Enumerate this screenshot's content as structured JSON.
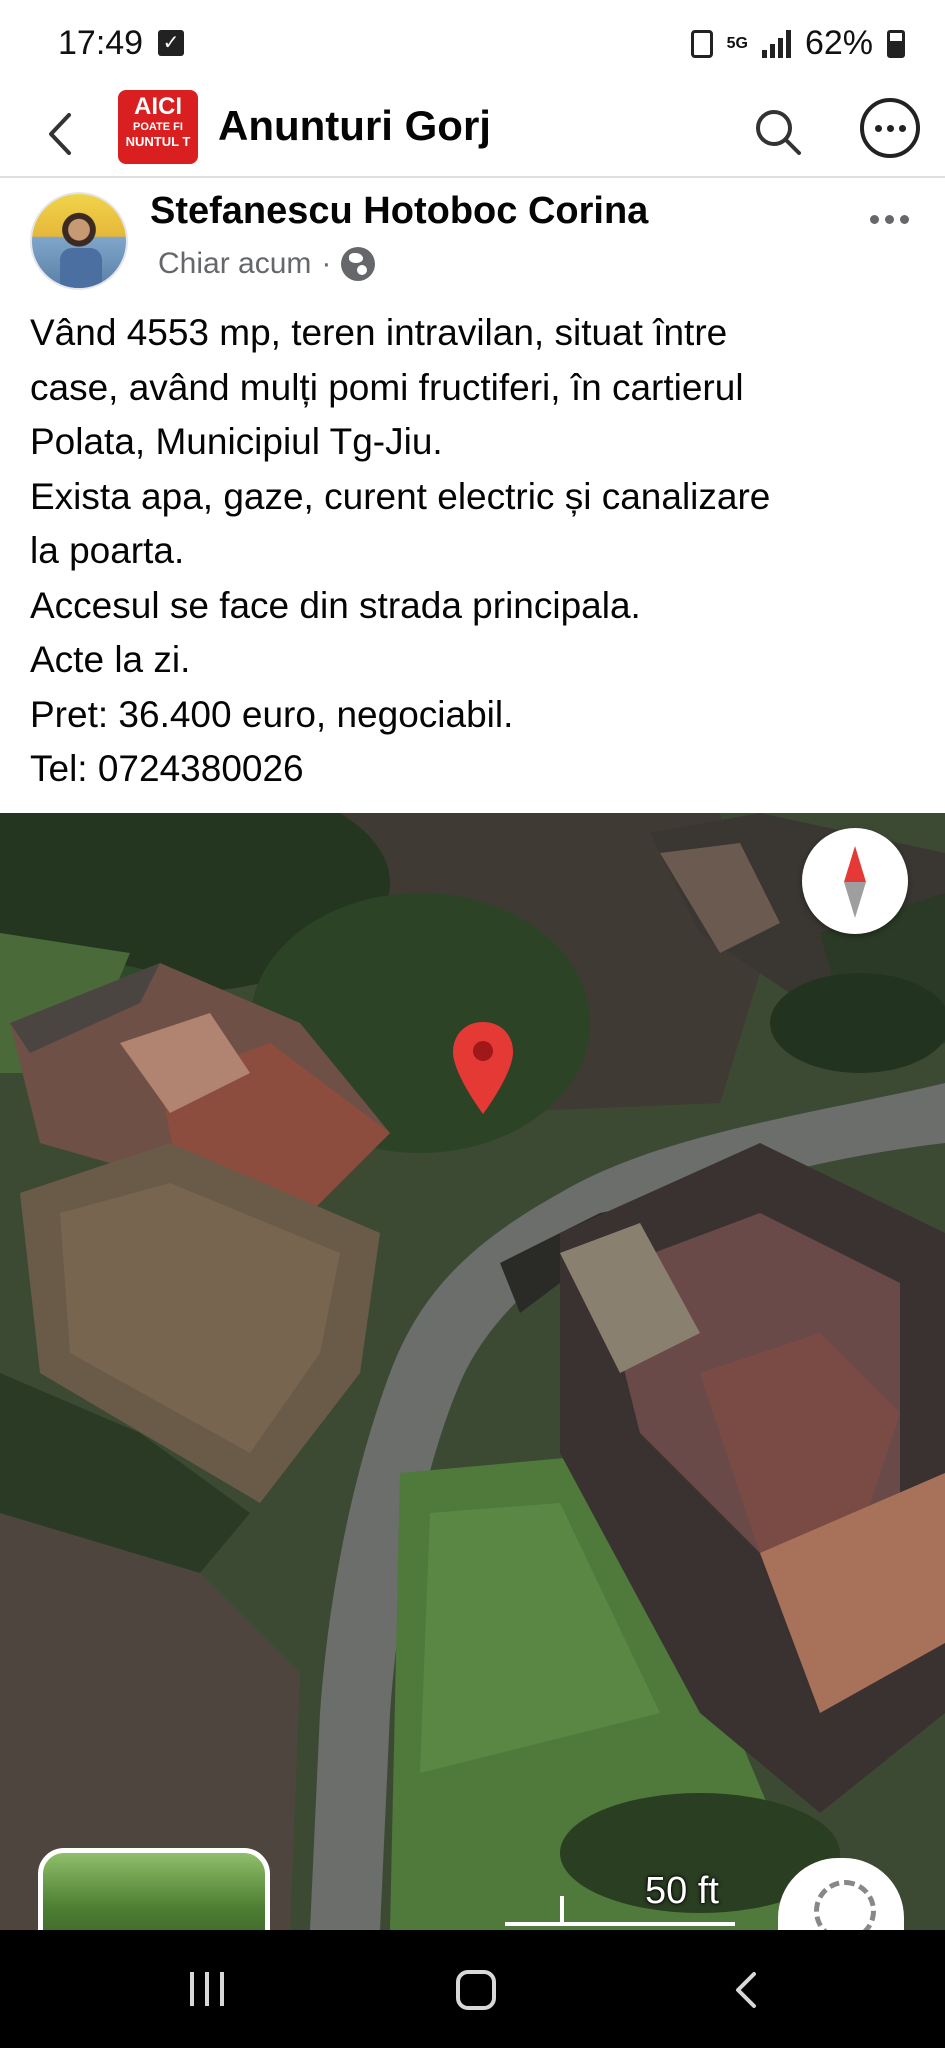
{
  "status_bar": {
    "time": "17:49",
    "network": "5G",
    "battery": "62%"
  },
  "header": {
    "logo_lines": [
      "AICI",
      "POATE FI",
      "NUNTUL T"
    ],
    "group_title": "Anunturi Gorj",
    "icons": [
      "back-arrow-icon",
      "search-icon",
      "more-options-icon"
    ]
  },
  "post": {
    "author": "Stefanescu Hotoboc Corina",
    "timestamp": "Chiar acum",
    "separator": "·",
    "privacy_icon": "globe-icon",
    "lines": [
      "Vând 4553 mp, teren intravilan, situat între",
      "case, având mulți pomi fructiferi, în cartierul",
      "Polata, Municipiul Tg-Jiu.",
      "Exista apa, gaze, curent electric și canalizare",
      "la poarta.",
      "Accesul se face din strada principala.",
      "Acte la zi.",
      "Pret: 36.400 euro, negociabil.",
      "Tel: 0724380026"
    ]
  },
  "map": {
    "scale_label": "50 ft",
    "pin_color": "#e53935",
    "compass_north_color": "#e53935"
  },
  "colors": {
    "text_primary": "#050505",
    "text_secondary": "#65676b",
    "brand_red": "#d91f1f"
  }
}
